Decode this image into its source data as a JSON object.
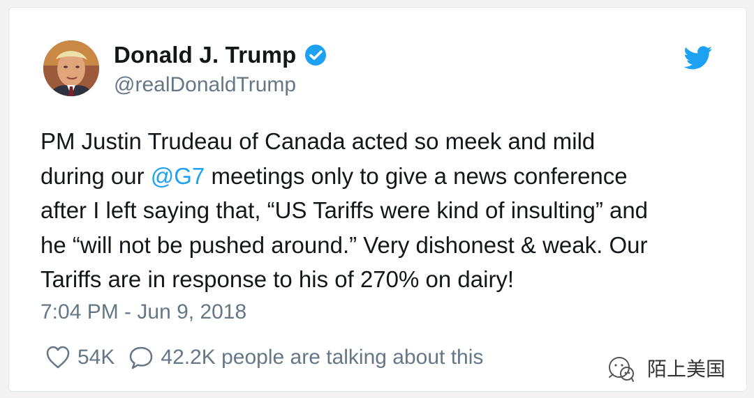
{
  "tweet": {
    "display_name": "Donald J. Trump",
    "handle": "@realDonaldTrump",
    "verified": true,
    "text_lines": [
      "PM Justin Trudeau of Canada acted so meek and mild",
      "during our ",
      "@G7",
      " meetings only to give a news conference",
      "after I left saying that, “US Tariffs were kind of insulting” and",
      "he “will not be pushed around.” Very dishonest & weak. Our",
      "Tariffs are in response to his of 270% on dairy!"
    ],
    "timestamp": "7:04 PM - Jun 9, 2018",
    "likes_count": "54K",
    "talking_about": "42.2K people are talking about this"
  },
  "icons": {
    "avatar": "avatar-photo",
    "verified": "verified-badge-icon",
    "twitter": "twitter-bird-icon",
    "like": "heart-icon",
    "reply": "speech-bubble-icon",
    "watermark": "wechat-logo-icon"
  },
  "watermark": {
    "text": "陌上美国"
  },
  "colors": {
    "brand_blue": "#1da1f2",
    "text_primary": "#14171a",
    "text_secondary": "#657786",
    "card_border": "#e1e8ed"
  }
}
